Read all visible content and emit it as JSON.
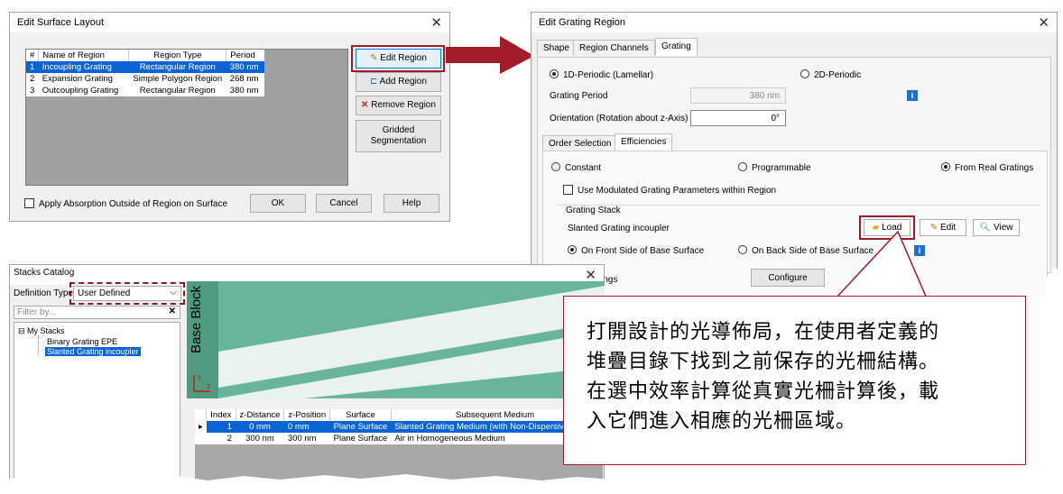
{
  "edit_surface": {
    "title": "Edit Surface Layout",
    "columns": [
      "#",
      "Name of Region",
      "Region Type",
      "Period"
    ],
    "rows": [
      [
        "1",
        "Incoupling Grating",
        "Rectangular Region",
        "380 nm"
      ],
      [
        "2",
        "Expansion Grating",
        "Simple Polygon Region",
        "268 nm"
      ],
      [
        "3",
        "Outcoupling Grating",
        "Rectangular Region",
        "380 nm"
      ]
    ],
    "edit_region": "Edit Region",
    "add_region": "Add Region",
    "remove_region": "Remove Region",
    "gridded_1": "Gridded",
    "gridded_2": "Segmentation",
    "apply_absorption": "Apply Absorption Outside of Region on Surface",
    "ok": "OK",
    "cancel": "Cancel",
    "help": "Help"
  },
  "grating_region": {
    "title": "Edit Grating Region",
    "tabs": [
      "Shape",
      "Region Channels",
      "Grating"
    ],
    "periodic_1d": "1D-Periodic (Lamellar)",
    "periodic_2d": "2D-Periodic",
    "grating_period_label": "Grating Period",
    "grating_period_value": "380 nm",
    "orientation_label": "Orientation (Rotation about z-Axis)",
    "orientation_value": "0°",
    "subtabs": [
      "Order Selection",
      "Efficiencies"
    ],
    "constant": "Constant",
    "programmable": "Programmable",
    "from_real": "From Real Gratings",
    "use_modulated": "Use Modulated Grating Parameters within Region",
    "stack_group": "Grating Stack",
    "stack_name": "Slanted Grating incoupler",
    "load": "Load",
    "edit": "Edit",
    "view": "View",
    "front_side": "On Front Side of Base Surface",
    "back_side": "On Back Side of Base Surface",
    "settings_partial": "ings",
    "configure": "Configure"
  },
  "stacks_catalog": {
    "title": "Stacks Catalog",
    "def_type_label": "Definition Type",
    "def_type_value": "User Defined",
    "filter_placeholder": "Filter by...",
    "tree_root": "My Stacks",
    "tree_items": [
      "Binary Grating EPE",
      "Slanted Grating incoupler"
    ],
    "base_block": "Base Block",
    "axis_x": "x",
    "axis_z": "z",
    "columns": [
      "Index",
      "z-Distance",
      "z-Position",
      "Surface",
      "Subsequent Medium"
    ],
    "rows": [
      [
        "1",
        "0 mm",
        "0 mm",
        "Plane Surface",
        "Slanted Grating Medium (with Non-Dispersive Material (h"
      ],
      [
        "2",
        "300 nm",
        "300 nm",
        "Plane Surface",
        "Air in Homogeneous Medium"
      ]
    ]
  },
  "callout": {
    "line1": "打開設計的光導佈局，在使用者定義的",
    "line2": "堆疊目錄下找到之前保存的光柵結構。",
    "line3": "在選中效率計算從真實光柵計算後，載",
    "line4": "入它們進入相應的光柵區域。"
  },
  "colors": {
    "accent_red": "#9e1b2a",
    "selection_blue": "#0a64d3",
    "grating_green": "#69b59a"
  }
}
